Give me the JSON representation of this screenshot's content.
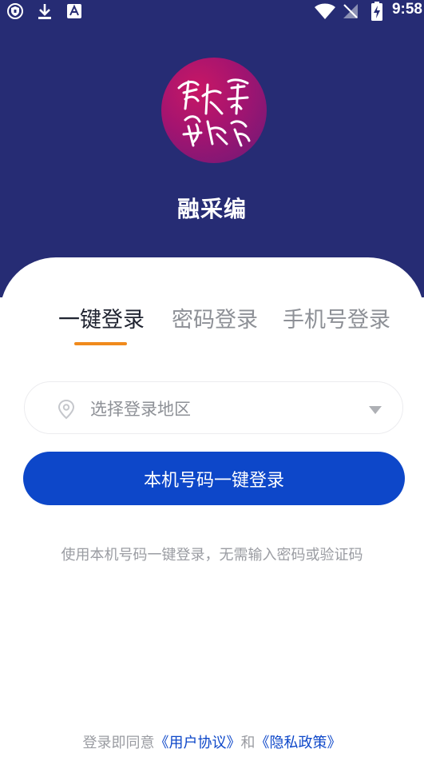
{
  "status_bar": {
    "time": "9:58",
    "icons": [
      "vpn-shield-icon",
      "download-icon",
      "font-a-icon",
      "wifi-icon",
      "no-signal-icon",
      "battery-charging-icon"
    ]
  },
  "app": {
    "name": "融采编",
    "logo_icon": "calligraphy-logo-icon"
  },
  "tabs": [
    {
      "label": "一键登录",
      "active": true
    },
    {
      "label": "密码登录",
      "active": false
    },
    {
      "label": "手机号登录",
      "active": false
    }
  ],
  "region": {
    "label": "选择登录地区",
    "icon": "location-pin-icon",
    "dropdown_icon": "triangle-down-icon"
  },
  "login_button": {
    "label": "本机号码一键登录"
  },
  "hint": "使用本机号码一键登录，无需输入密码或验证码",
  "agreement": {
    "prefix": "登录即同意",
    "user_agreement": "《用户协议》",
    "conjunction": "和",
    "privacy_policy": "《隐私政策》"
  },
  "colors": {
    "header_bg": "#262c74",
    "accent_orange": "#f08a1c",
    "primary_blue": "#0d47c9",
    "logo_magenta": "#b0156c"
  }
}
